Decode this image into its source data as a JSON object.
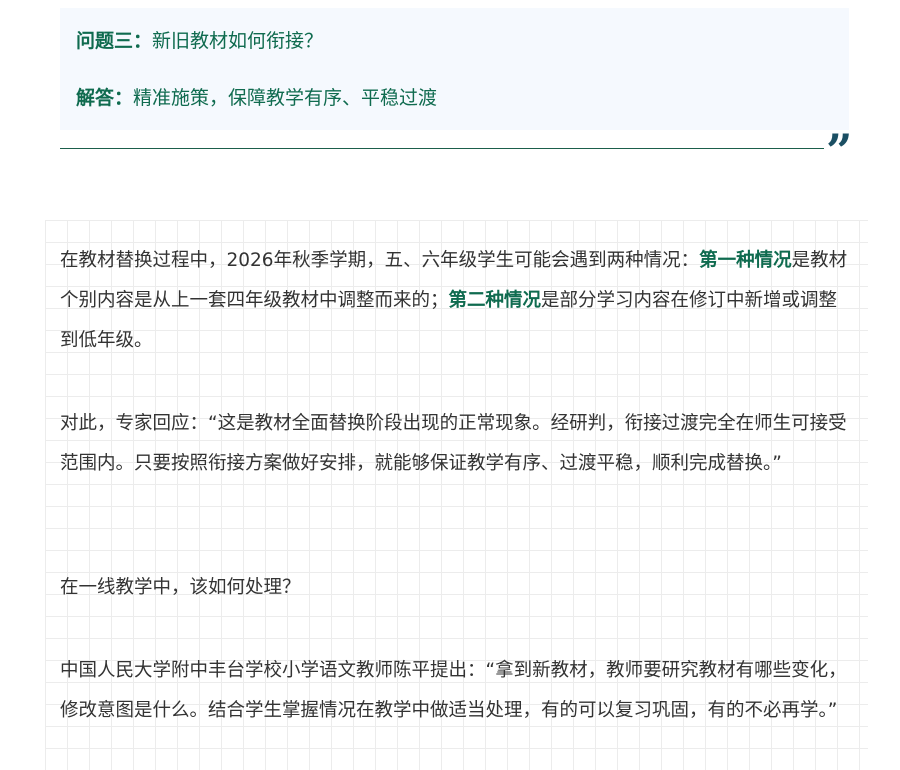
{
  "qa": {
    "question_label": "问题三：",
    "question_text": "新旧教材如何衔接？",
    "answer_label": "解答：",
    "answer_text": "精准施策，保障教学有序、平稳过渡"
  },
  "quote_mark": "”",
  "paragraphs": {
    "p1": {
      "part1": "在教材替换过程中，2026年秋季学期，五、六年级学生可能会遇到两种情况：",
      "hl1": "第一种情况",
      "part2": "是教材个别内容是从上一套四年级教材中调整而来的；",
      "hl2": "第二种情况",
      "part3": "是部分学习内容在修订中新增或调整到低年级。"
    },
    "p2": "对此，专家回应：“这是教材全面替换阶段出现的正常现象。经研判，衔接过渡完全在师生可接受范围内。只要按照衔接方案做好安排，就能够保证教学有序、过渡平稳，顺利完成替换。”",
    "p3": "在一线教学中，该如何处理？",
    "p4": "中国人民大学附中丰台学校小学语文教师陈平提出：“拿到新教材，教师要研究教材有哪些变化，修改意图是什么。结合学生掌握情况在教学中做适当处理，有的可以复习巩固，有的不必再学。”"
  }
}
